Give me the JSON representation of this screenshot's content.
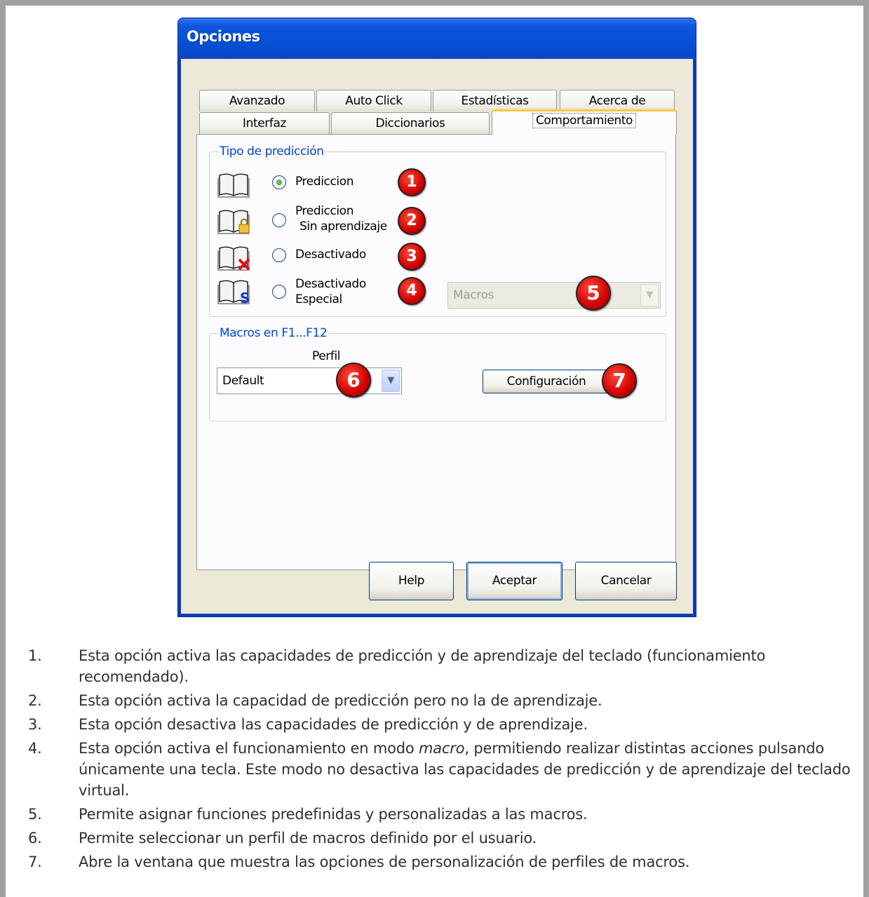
{
  "dialog": {
    "title": "Opciones",
    "tabs_row1": [
      "Avanzado",
      "Auto Click",
      "Estadísticas",
      "Acerca de"
    ],
    "tabs_row2": [
      "Interfaz",
      "Diccionarios",
      "Comportamiento"
    ],
    "active_tab": "Comportamiento"
  },
  "prediction_group": {
    "legend": "Tipo de predicción",
    "options": [
      {
        "line1": "Prediccion",
        "line2": "",
        "selected": true,
        "badge": "1"
      },
      {
        "line1": "Prediccion",
        "line2": "Sin aprendizaje",
        "selected": false,
        "badge": "2"
      },
      {
        "line1": "Desactivado",
        "line2": "",
        "selected": false,
        "badge": "3"
      },
      {
        "line1": "Desactivado",
        "line2": "Especial",
        "selected": false,
        "badge": "4"
      }
    ],
    "macros_select": {
      "value": "Macros",
      "enabled": false,
      "badge": "5"
    }
  },
  "macros_group": {
    "legend": "Macros en F1...F12",
    "profile_label": "Perfil",
    "profile_value": "Default",
    "profile_badge": "6",
    "config_button": "Configuración",
    "config_badge": "7"
  },
  "footer_buttons": {
    "help": "Help",
    "accept": "Aceptar",
    "cancel": "Cancelar"
  },
  "descriptions": [
    {
      "num": "1.",
      "text": "Esta opción activa las capacidades de predicción y de aprendizaje del teclado (funcionamiento recomendado)."
    },
    {
      "num": "2.",
      "text": "Esta opción activa la capacidad de predicción pero no la de aprendizaje."
    },
    {
      "num": "3.",
      "text": "Esta opción desactiva las capacidades de predicción y de aprendizaje."
    },
    {
      "num": "4.",
      "text_before": "Esta opción activa el funcionamiento en modo ",
      "text_italic": "macro",
      "text_after": ", permitiendo realizar distintas acciones pulsando únicamente una tecla. Este modo no desactiva las capacidades de predicción y de aprendizaje del teclado virtual."
    },
    {
      "num": "5.",
      "text": "Permite asignar funciones predefinidas y personalizadas a las macros."
    },
    {
      "num": "6.",
      "text": "Permite seleccionar un perfil de macros definido por el usuario."
    },
    {
      "num": "7.",
      "text": "Abre la ventana que muestra las opciones de personalización de perfiles de macros."
    }
  ],
  "colors": {
    "titlebar": "#0650d6",
    "legend": "#0046d5",
    "badge": "#d10000",
    "dialog_bg": "#ece9d8"
  }
}
